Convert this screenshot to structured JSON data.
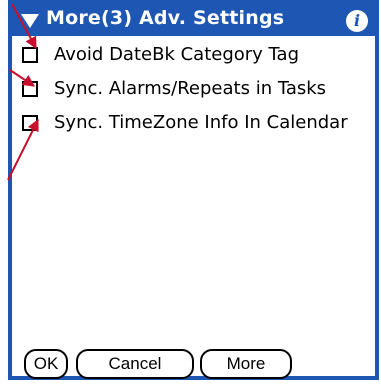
{
  "window": {
    "title": "More(3) Adv. Settings",
    "info_glyph": "i"
  },
  "options": [
    {
      "label": "Avoid DateBk Category Tag",
      "checked": false
    },
    {
      "label": "Sync. Alarms/Repeats in Tasks",
      "checked": false
    },
    {
      "label": "Sync. TimeZone Info In Calendar",
      "checked": false
    }
  ],
  "buttons": {
    "ok": "OK",
    "cancel": "Cancel",
    "more": "More"
  },
  "colors": {
    "titlebar": "#1e56b4",
    "annotation_arrow": "#c8102e"
  }
}
